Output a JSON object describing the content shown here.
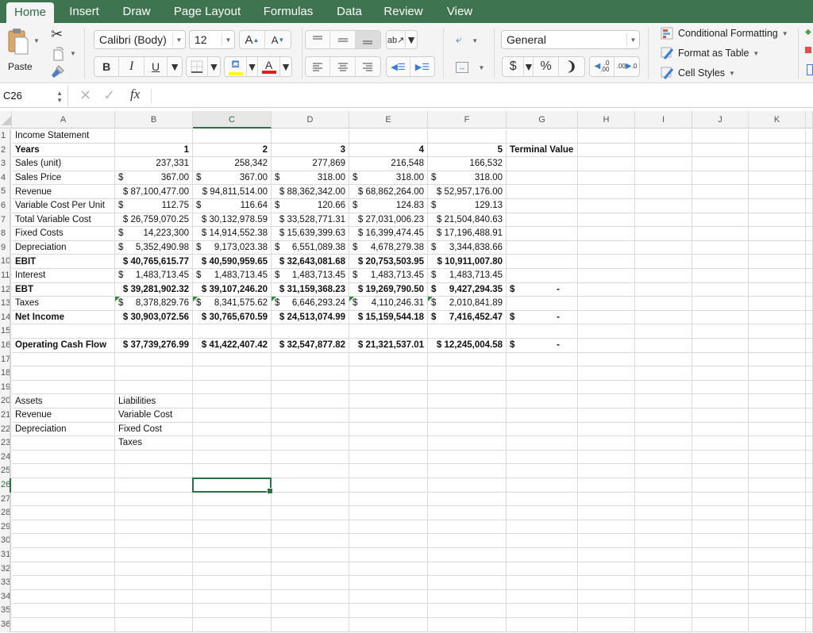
{
  "ribbon_tabs": [
    "Home",
    "Insert",
    "Draw",
    "Page Layout",
    "Formulas",
    "Data",
    "Review",
    "View"
  ],
  "active_tab": "Home",
  "clipboard": {
    "paste_label": "Paste"
  },
  "font": {
    "name": "Calibri (Body)",
    "size": "12",
    "bold": "B",
    "italic": "I",
    "underline": "U",
    "increase": "A",
    "decrease": "A",
    "fill_color": "#ffff00",
    "font_color": "#e02020"
  },
  "number": {
    "format": "General",
    "currency": "$",
    "percent": "%",
    "comma": "›",
    "inc_decimal": ".0\n.00",
    "dec_decimal": ".00\n.0"
  },
  "styles": {
    "conditional_formatting": "Conditional Formatting",
    "format_as_table": "Format as Table",
    "cell_styles": "Cell Styles"
  },
  "formula_bar": {
    "name_box": "C26",
    "fx": "fx",
    "formula": ""
  },
  "columns": [
    "A",
    "B",
    "C",
    "D",
    "E",
    "F",
    "G",
    "H",
    "I",
    "J",
    "K"
  ],
  "selected_column": "C",
  "selected_row": 26,
  "selected_cell": "C26",
  "rows": [
    {
      "n": 1,
      "bold": false,
      "cells": {
        "A": "Income Statement"
      }
    },
    {
      "n": 2,
      "bold": true,
      "cells": {
        "A": "Years",
        "B": "1",
        "C": "2",
        "D": "3",
        "E": "4",
        "F": "5",
        "G": "Terminal Value"
      }
    },
    {
      "n": 3,
      "bold": false,
      "cells": {
        "A": "Sales (unit)",
        "B": "237,331",
        "C": "258,342",
        "D": "277,869",
        "E": "216,548",
        "F": "166,532"
      }
    },
    {
      "n": 4,
      "bold": false,
      "cells": {
        "A": "Sales Price",
        "B": "$|367.00",
        "C": "$|367.00",
        "D": "$|318.00",
        "E": "$|318.00",
        "F": "$|318.00"
      }
    },
    {
      "n": 5,
      "bold": false,
      "cells": {
        "A": "Revenue",
        "B": "$ 87,100,477.00",
        "C": "$ 94,811,514.00",
        "D": "$ 88,362,342.00",
        "E": "$ 68,862,264.00",
        "F": "$ 52,957,176.00"
      }
    },
    {
      "n": 6,
      "bold": false,
      "cells": {
        "A": "Variable Cost Per Unit",
        "B": "$|112.75",
        "C": "$|116.64",
        "D": "$|120.66",
        "E": "$|124.83",
        "F": "$|129.13"
      }
    },
    {
      "n": 7,
      "bold": false,
      "cells": {
        "A": "Total Variable Cost",
        "B": "$ 26,759,070.25",
        "C": "$ 30,132,978.59",
        "D": "$ 33,528,771.31",
        "E": "$ 27,031,006.23",
        "F": "$ 21,504,840.63"
      }
    },
    {
      "n": 8,
      "bold": false,
      "cells": {
        "A": "Fixed Costs",
        "B": "$|14,223,300",
        "C": "$ 14,914,552.38",
        "D": "$ 15,639,399.63",
        "E": "$ 16,399,474.45",
        "F": "$ 17,196,488.91"
      }
    },
    {
      "n": 9,
      "bold": false,
      "cells": {
        "A": "Depreciation",
        "B": "$|5,352,490.98",
        "C": "$|9,173,023.38",
        "D": "$|6,551,089.38",
        "E": "$|4,678,279.38",
        "F": "$|3,344,838.66"
      }
    },
    {
      "n": 10,
      "bold": true,
      "cells": {
        "A": "EBIT",
        "B": "$ 40,765,615.77",
        "C": "$ 40,590,959.65",
        "D": "$ 32,643,081.68",
        "E": "$ 20,753,503.95",
        "F": "$ 10,911,007.80"
      }
    },
    {
      "n": 11,
      "bold": false,
      "cells": {
        "A": "Interest",
        "B": "$|1,483,713.45",
        "C": "$|1,483,713.45",
        "D": "$|1,483,713.45",
        "E": "$|1,483,713.45",
        "F": "$|1,483,713.45"
      }
    },
    {
      "n": 12,
      "bold": true,
      "cells": {
        "A": "EBT",
        "B": "$ 39,281,902.32",
        "C": "$ 39,107,246.20",
        "D": "$ 31,159,368.23",
        "E": "$ 19,269,790.50",
        "F": "$|9,427,294.35",
        "G": "$|-"
      }
    },
    {
      "n": 13,
      "bold": false,
      "tri": [
        "B",
        "C",
        "D",
        "E",
        "F"
      ],
      "cells": {
        "A": "Taxes",
        "B": "$|8,378,829.76",
        "C": "$|8,341,575.62",
        "D": "$|6,646,293.24",
        "E": "$|4,110,246.31",
        "F": "$|2,010,841.89"
      }
    },
    {
      "n": 14,
      "bold": true,
      "cells": {
        "A": "Net Income",
        "B": "$ 30,903,072.56",
        "C": "$ 30,765,670.59",
        "D": "$ 24,513,074.99",
        "E": "$ 15,159,544.18",
        "F": "$|7,416,452.47",
        "G": "$|-"
      }
    },
    {
      "n": 15,
      "bold": false,
      "cells": {}
    },
    {
      "n": 16,
      "bold": true,
      "cells": {
        "A": "Operating Cash Flow",
        "B": "$ 37,739,276.99",
        "C": "$ 41,422,407.42",
        "D": "$ 32,547,877.82",
        "E": "$ 21,321,537.01",
        "F": "$ 12,245,004.58",
        "G": "$|-"
      }
    },
    {
      "n": 17,
      "bold": false,
      "cells": {}
    },
    {
      "n": 18,
      "bold": false,
      "cells": {}
    },
    {
      "n": 19,
      "bold": false,
      "cells": {}
    },
    {
      "n": 20,
      "bold": false,
      "cells": {
        "A": "Assets",
        "B": "Liabilities"
      }
    },
    {
      "n": 21,
      "bold": false,
      "cells": {
        "A": "Revenue",
        "B": "Variable Cost"
      }
    },
    {
      "n": 22,
      "bold": false,
      "cells": {
        "A": "Depreciation",
        "B": "Fixed Cost"
      }
    },
    {
      "n": 23,
      "bold": false,
      "cells": {
        "B": "Taxes"
      }
    },
    {
      "n": 24,
      "bold": false,
      "cells": {}
    },
    {
      "n": 25,
      "bold": false,
      "cells": {}
    },
    {
      "n": 26,
      "bold": false,
      "cells": {}
    },
    {
      "n": 27,
      "bold": false,
      "cells": {}
    },
    {
      "n": 28,
      "bold": false,
      "cells": {}
    },
    {
      "n": 29,
      "bold": false,
      "cells": {}
    },
    {
      "n": 30,
      "bold": false,
      "cells": {}
    },
    {
      "n": 31,
      "bold": false,
      "cells": {}
    },
    {
      "n": 32,
      "bold": false,
      "cells": {}
    },
    {
      "n": 33,
      "bold": false,
      "cells": {}
    },
    {
      "n": 34,
      "bold": false,
      "cells": {}
    },
    {
      "n": 35,
      "bold": false,
      "cells": {}
    },
    {
      "n": 36,
      "bold": false,
      "cells": {}
    }
  ]
}
